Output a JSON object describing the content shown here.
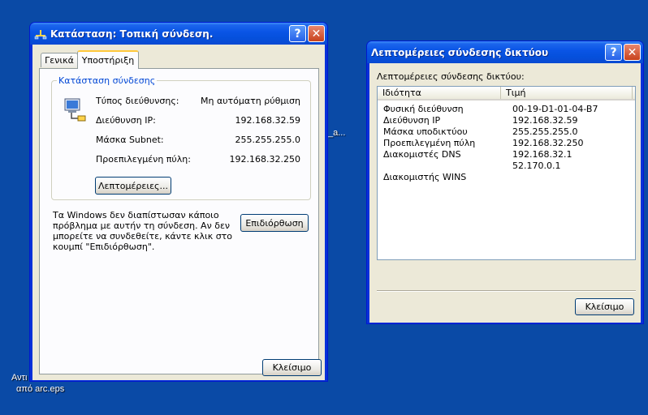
{
  "desktop": {
    "label_arc": "_a...",
    "label_icon_line1": "Αντι",
    "label_icon_line2": "από arc.eps"
  },
  "status_window": {
    "title": "Κατάσταση: Τοπική σύνδεση.",
    "help_glyph": "?",
    "close_glyph": "✕",
    "tabs": [
      "Γενικά",
      "Υποστήριξη"
    ],
    "active_tab": "Υποστήριξη",
    "group_title": "Κατάσταση σύνδεσης",
    "fields": [
      {
        "label": "Τύπος διεύθυνσης:",
        "value": "Μη αυτόματη ρύθμιση"
      },
      {
        "label": "Διεύθυνση IP:",
        "value": "192.168.32.59"
      },
      {
        "label": "Μάσκα Subnet:",
        "value": "255.255.255.0"
      },
      {
        "label": "Προεπιλεγμένη πύλη:",
        "value": "192.168.32.250"
      }
    ],
    "details_button": "Λεπτομέρειες...",
    "message_lines": [
      "Τα Windows δεν διαπίστωσαν κάποιο",
      "πρόβλημα με αυτήν τη σύνδεση. Αν δεν",
      "μπορείτε να συνδεθείτε, κάντε κλικ στο",
      "κουμπί \"Επιδιόρθωση\"."
    ],
    "repair_button": "Επιδιόρθωση",
    "close_button": "Κλείσιμο"
  },
  "details_window": {
    "title": "Λεπτομέρειες σύνδεσης δικτύου",
    "help_glyph": "?",
    "close_glyph": "✕",
    "caption": "Λεπτομέρειες σύνδεσης δικτύου:",
    "columns": [
      "Ιδιότητα",
      "Τιμή"
    ],
    "rows": [
      {
        "property": "Φυσική διεύθυνση",
        "value": "00-19-D1-01-04-B7"
      },
      {
        "property": "Διεύθυνση IP",
        "value": "192.168.32.59"
      },
      {
        "property": "Μάσκα υποδικτύου",
        "value": "255.255.255.0"
      },
      {
        "property": "Προεπιλεγμένη πύλη",
        "value": "192.168.32.250"
      },
      {
        "property": "Διακομιστές DNS",
        "value": "192.168.32.1"
      },
      {
        "property": "",
        "value": "52.170.0.1"
      },
      {
        "property": "Διακομιστής WINS",
        "value": ""
      }
    ],
    "close_button": "Κλείσιμο"
  },
  "colors": {
    "desktop": "#0a4aa6",
    "titlebar": "#0a55e6",
    "dialog_face": "#ece9d8",
    "group_title": "#0046d5"
  }
}
